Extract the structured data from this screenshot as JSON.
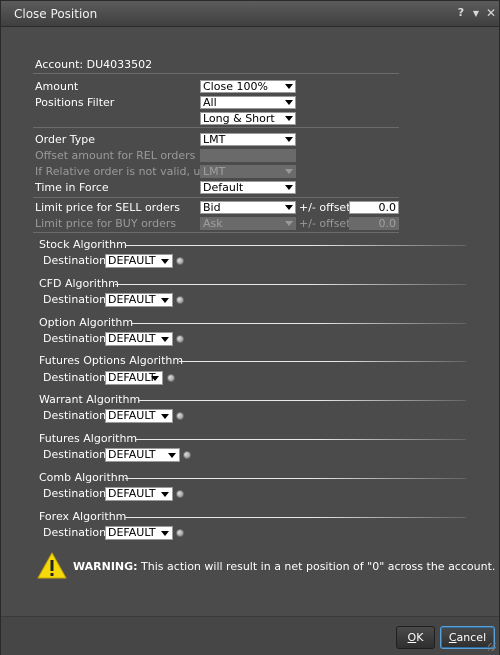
{
  "window": {
    "title": "Close Position",
    "help": "?",
    "minimize": "▼",
    "close": "✕"
  },
  "account": {
    "label": "Account: DU4033502"
  },
  "amount": {
    "label": "Amount",
    "value": "Close 100%"
  },
  "positions_filter": {
    "label": "Positions Filter",
    "value1": "All",
    "value2": "Long & Short"
  },
  "order_type": {
    "label": "Order Type",
    "value": "LMT"
  },
  "offset_rel": {
    "label": "Offset amount for REL orders"
  },
  "relative_invalid": {
    "label": "If Relative order is not valid, use",
    "value": "LMT"
  },
  "time_in_force": {
    "label": "Time in Force",
    "value": "Default"
  },
  "limit_sell": {
    "label": "Limit price for SELL orders",
    "value": "Bid",
    "offset_label": "+/- offset",
    "offset_value": "0.0"
  },
  "limit_buy": {
    "label": "Limit price for BUY orders",
    "value": "Ask",
    "offset_label": "+/- offset",
    "offset_value": "0.0"
  },
  "algorithms": [
    {
      "title": "Stock Algorithm",
      "dest_label": "Destination",
      "dest_value": "DEFAULT"
    },
    {
      "title": "CFD Algorithm",
      "dest_label": "Destination",
      "dest_value": "DEFAULT"
    },
    {
      "title": "Option Algorithm",
      "dest_label": "Destination",
      "dest_value": "DEFAULT"
    },
    {
      "title": "Futures Options Algorithm",
      "dest_label": "Destination",
      "dest_value": "DEFAULT"
    },
    {
      "title": "Warrant Algorithm",
      "dest_label": "Destination",
      "dest_value": "DEFAULT"
    },
    {
      "title": "Futures Algorithm",
      "dest_label": "Destination",
      "dest_value": "DEFAULT"
    },
    {
      "title": "Comb Algorithm",
      "dest_label": "Destination",
      "dest_value": "DEFAULT"
    },
    {
      "title": "Forex Algorithm",
      "dest_label": "Destination",
      "dest_value": "DEFAULT"
    }
  ],
  "warning": {
    "prefix": "WARNING:",
    "text": " This action will result in a net position of \"0\" across the account."
  },
  "buttons": {
    "ok_u": "O",
    "ok_rest": "K",
    "cancel_u": "C",
    "cancel_rest": "ancel"
  },
  "colors": {
    "background": "#4b4b4b",
    "warning_yellow": "#f5d90a",
    "focus_blue": "#5aa0d6"
  },
  "icons": {
    "warning": "warning-triangle-icon",
    "info": "info-circle-icon"
  }
}
